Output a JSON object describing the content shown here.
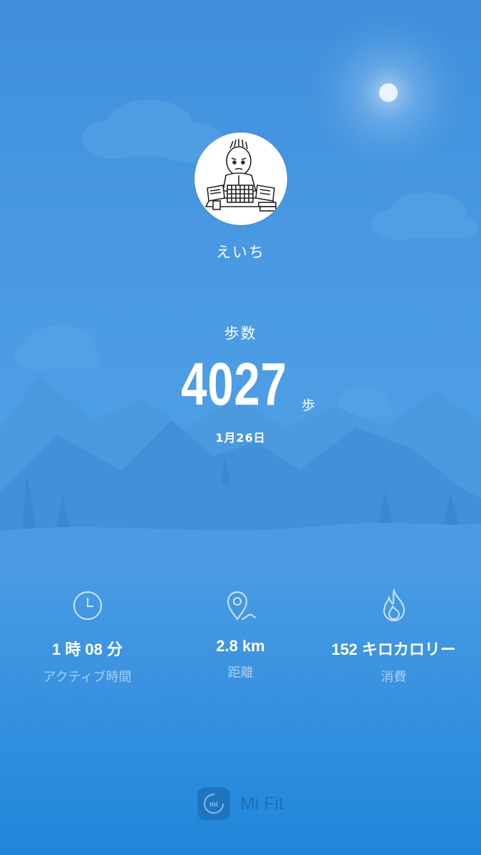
{
  "profile": {
    "username": "えいち"
  },
  "steps": {
    "label": "歩数",
    "value": "4027",
    "unit": "歩",
    "date": "1月26日"
  },
  "stats": [
    {
      "icon": "clock-icon",
      "value": "1 時 08 分",
      "label": "アクティブ時間"
    },
    {
      "icon": "location-pin-icon",
      "value": "2.8 km",
      "label": "距離"
    },
    {
      "icon": "flame-icon",
      "value": "152 キロカロリー",
      "label": "消費"
    }
  ],
  "brand": {
    "name": "Mi Fit",
    "logo_text": "mi"
  },
  "colors": {
    "background_top": "#3f8fdc",
    "background_bottom": "#1f86da",
    "text": "#ffffff",
    "label_muted": "rgba(255,255,255,0.55)"
  }
}
